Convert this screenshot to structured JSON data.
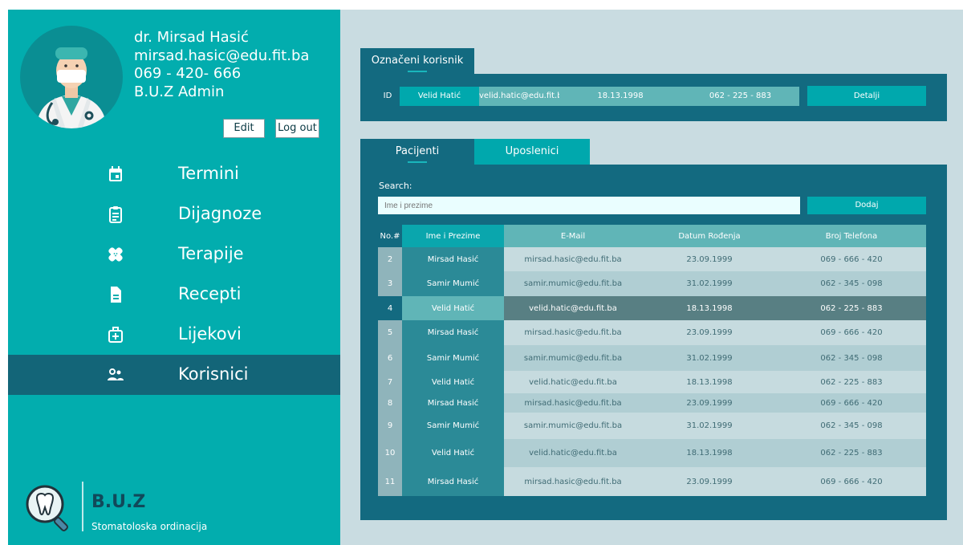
{
  "profile": {
    "name": "dr. Mirsad Hasić",
    "email": "mirsad.hasic@edu.fit.ba",
    "phone": "069 - 420- 666",
    "role": "B.U.Z Admin",
    "edit_label": "Edit",
    "logout_label": "Log out"
  },
  "nav": [
    {
      "label": "Termini",
      "icon": "calendar-icon"
    },
    {
      "label": "Dijagnoze",
      "icon": "clipboard-icon"
    },
    {
      "label": "Terapije",
      "icon": "bandage-icon"
    },
    {
      "label": "Recepti",
      "icon": "document-icon"
    },
    {
      "label": "Lijekovi",
      "icon": "medkit-icon"
    },
    {
      "label": "Korisnici",
      "icon": "users-icon",
      "active": true
    }
  ],
  "brand": {
    "name": "B.U.Z",
    "subtitle": "Stomatoloska ordinacija"
  },
  "selected_user": {
    "tab_label": "Označeni korisnik",
    "id_label": "ID",
    "name": "Velid Hatić",
    "email": "velid.hatic@edu.fit.ba",
    "date": "18.13.1998",
    "phone": "062 - 225 - 883",
    "details_label": "Detalji"
  },
  "list_panel": {
    "tabs": [
      "Pacijenti",
      "Uposlenici"
    ],
    "search_label": "Search:",
    "search_placeholder": "Ime i prezime",
    "add_label": "Dodaj",
    "columns": [
      "No.#",
      "Ime i Prezime",
      "E-Mail",
      "Datum Rođenja",
      "Broj Telefona"
    ],
    "rows": [
      {
        "no": "2",
        "name": "Mirsad Hasić",
        "email": "mirsad.hasic@edu.fit.ba",
        "date": "23.09.1999",
        "phone": "069 - 666 - 420"
      },
      {
        "no": "3",
        "name": "Samir Mumić",
        "email": "samir.mumic@edu.fit.ba",
        "date": "31.02.1999",
        "phone": "062 - 345 - 098"
      },
      {
        "no": "4",
        "name": "Velid Hatić",
        "email": "velid.hatic@edu.fit.ba",
        "date": "18.13.1998",
        "phone": "062 - 225 - 883"
      },
      {
        "no": "5",
        "name": "Mirsad Hasić",
        "email": "mirsad.hasic@edu.fit.ba",
        "date": "23.09.1999",
        "phone": "069 - 666 - 420"
      },
      {
        "no": "6",
        "name": "Samir Mumić",
        "email": "samir.mumic@edu.fit.ba",
        "date": "31.02.1999",
        "phone": "062 - 345 - 098"
      },
      {
        "no": "7",
        "name": "Velid Hatić",
        "email": "velid.hatic@edu.fit.ba",
        "date": "18.13.1998",
        "phone": "062 - 225 - 883"
      },
      {
        "no": "8",
        "name": "Mirsad Hasić",
        "email": "mirsad.hasic@edu.fit.ba",
        "date": "23.09.1999",
        "phone": "069 - 666 - 420"
      },
      {
        "no": "9",
        "name": "Samir Mumić",
        "email": "samir.mumic@edu.fit.ba",
        "date": "31.02.1999",
        "phone": "062 - 345 - 098"
      },
      {
        "no": "10",
        "name": "Velid Hatić",
        "email": "velid.hatic@edu.fit.ba",
        "date": "18.13.1998",
        "phone": "062 - 225 - 883"
      },
      {
        "no": "11",
        "name": "Mirsad Hasić",
        "email": "mirsad.hasic@edu.fit.ba",
        "date": "23.09.1999",
        "phone": "069 - 666 - 420"
      }
    ],
    "selected_row_no": "4"
  },
  "colors": {
    "sidebar": "#02adae",
    "sidebar_active": "#136578",
    "panel": "#136a80",
    "accent_button": "#00a8ad",
    "background": "#c9dce1"
  }
}
